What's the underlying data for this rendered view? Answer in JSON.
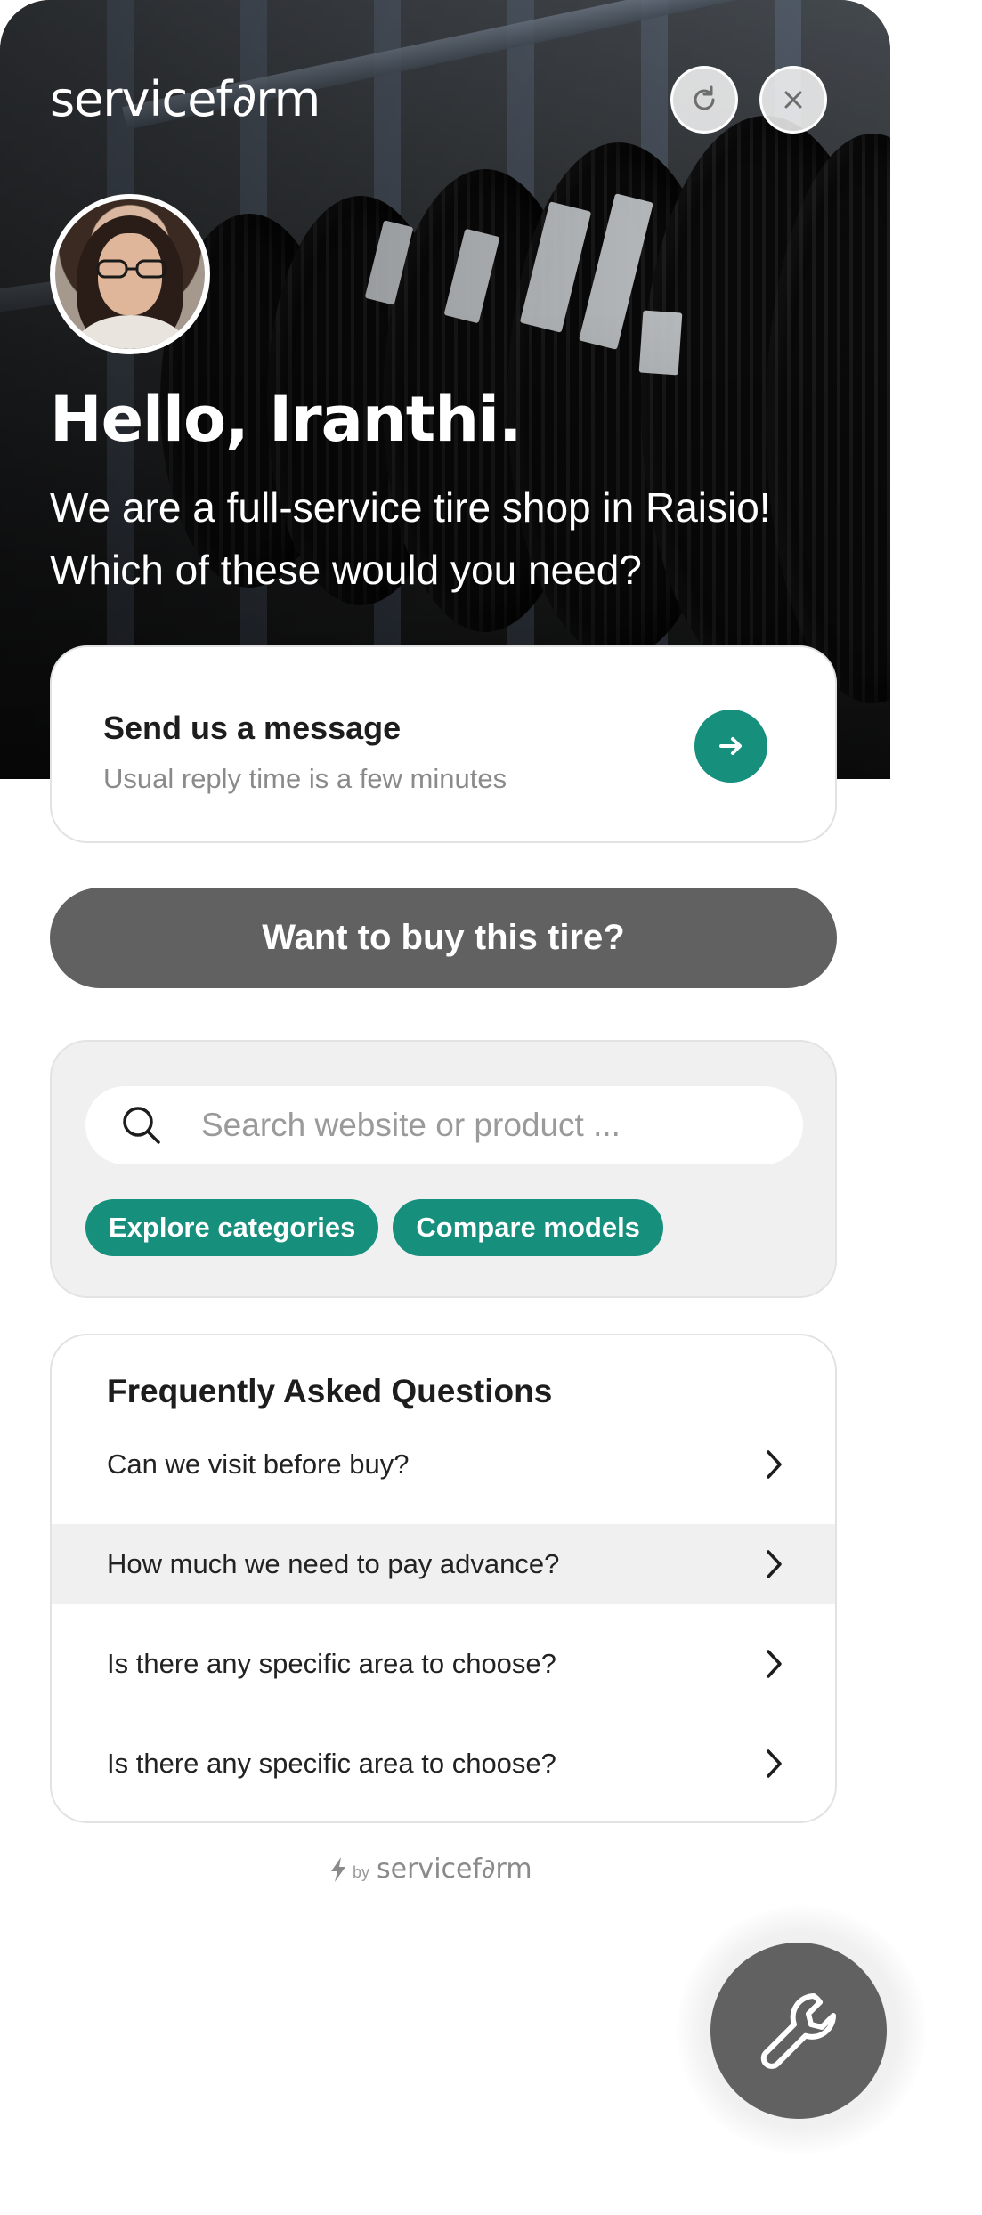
{
  "header": {
    "logo_text": "servicef∂rm",
    "refresh_icon": "refresh-icon",
    "close_icon": "close-icon"
  },
  "agent": {
    "avatar_icon": "agent-avatar"
  },
  "hero": {
    "greeting": "Hello, Iranthi.",
    "subtitle": "We are a full-service tire shop in Raisio! Which of these would you need?"
  },
  "message_card": {
    "title": "Send us a message",
    "subtitle": "Usual reply time is a few minutes",
    "icon": "arrow-right-icon"
  },
  "buy_button": {
    "label": "Want to buy this tire?"
  },
  "search": {
    "placeholder": "Search website or product ...",
    "icon": "search-icon",
    "chips": [
      "Explore categories",
      "Compare models"
    ]
  },
  "faq": {
    "title": "Frequently Asked Questions",
    "items": [
      {
        "question": "Can we visit before buy?"
      },
      {
        "question": "How much we need to pay advance?"
      },
      {
        "question": "Is there any specific area to choose?"
      },
      {
        "question": "Is there any specific area to choose?"
      }
    ]
  },
  "footer": {
    "powered_by": "by",
    "brand": "servicef∂rm"
  },
  "launcher": {
    "icon": "wrench-icon"
  },
  "colors": {
    "accent": "#168f7d",
    "dark_button": "#616161",
    "muted_text": "#8a8a8a"
  }
}
